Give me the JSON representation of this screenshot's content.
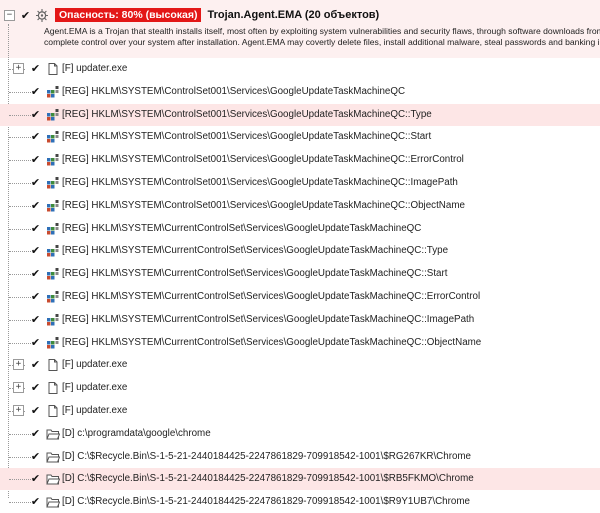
{
  "threat": {
    "collapse_symbol": "−",
    "severity_label": "Опасность: 80% (высокая)",
    "name": "Trojan.Agent.EMA (20 объектов)",
    "description_lines": [
      "Agent.EMA is a Trojan that stealth installs itself, most often by exploiting system vulnerabilities and security flaws, through software downloads from mali",
      "complete control over your system after installation. Agent.EMA may covertly delete files, install additional malware, steal passwords and banking informa"
    ]
  },
  "rows": [
    {
      "type": "file",
      "text": "[F] updater.exe",
      "expandable": true,
      "highlight": false
    },
    {
      "type": "reg",
      "text": "[REG] HKLM\\SYSTEM\\ControlSet001\\Services\\GoogleUpdateTaskMachineQC",
      "expandable": false,
      "highlight": false
    },
    {
      "type": "reg",
      "text": "[REG] HKLM\\SYSTEM\\ControlSet001\\Services\\GoogleUpdateTaskMachineQC::Type",
      "expandable": false,
      "highlight": true
    },
    {
      "type": "reg",
      "text": "[REG] HKLM\\SYSTEM\\ControlSet001\\Services\\GoogleUpdateTaskMachineQC::Start",
      "expandable": false,
      "highlight": false
    },
    {
      "type": "reg",
      "text": "[REG] HKLM\\SYSTEM\\ControlSet001\\Services\\GoogleUpdateTaskMachineQC::ErrorControl",
      "expandable": false,
      "highlight": false
    },
    {
      "type": "reg",
      "text": "[REG] HKLM\\SYSTEM\\ControlSet001\\Services\\GoogleUpdateTaskMachineQC::ImagePath",
      "expandable": false,
      "highlight": false
    },
    {
      "type": "reg",
      "text": "[REG] HKLM\\SYSTEM\\ControlSet001\\Services\\GoogleUpdateTaskMachineQC::ObjectName",
      "expandable": false,
      "highlight": false
    },
    {
      "type": "reg",
      "text": "[REG] HKLM\\SYSTEM\\CurrentControlSet\\Services\\GoogleUpdateTaskMachineQC",
      "expandable": false,
      "highlight": false
    },
    {
      "type": "reg",
      "text": "[REG] HKLM\\SYSTEM\\CurrentControlSet\\Services\\GoogleUpdateTaskMachineQC::Type",
      "expandable": false,
      "highlight": false
    },
    {
      "type": "reg",
      "text": "[REG] HKLM\\SYSTEM\\CurrentControlSet\\Services\\GoogleUpdateTaskMachineQC::Start",
      "expandable": false,
      "highlight": false
    },
    {
      "type": "reg",
      "text": "[REG] HKLM\\SYSTEM\\CurrentControlSet\\Services\\GoogleUpdateTaskMachineQC::ErrorControl",
      "expandable": false,
      "highlight": false
    },
    {
      "type": "reg",
      "text": "[REG] HKLM\\SYSTEM\\CurrentControlSet\\Services\\GoogleUpdateTaskMachineQC::ImagePath",
      "expandable": false,
      "highlight": false
    },
    {
      "type": "reg",
      "text": "[REG] HKLM\\SYSTEM\\CurrentControlSet\\Services\\GoogleUpdateTaskMachineQC::ObjectName",
      "expandable": false,
      "highlight": false
    },
    {
      "type": "file",
      "text": "[F] updater.exe",
      "expandable": true,
      "highlight": false
    },
    {
      "type": "file",
      "text": "[F] updater.exe",
      "expandable": true,
      "highlight": false
    },
    {
      "type": "file",
      "text": "[F] updater.exe",
      "expandable": true,
      "highlight": false
    },
    {
      "type": "dir",
      "text": "[D] c:\\programdata\\google\\chrome",
      "expandable": false,
      "highlight": false
    },
    {
      "type": "dir",
      "text": "[D] C:\\$Recycle.Bin\\S-1-5-21-2440184425-2247861829-709918542-1001\\$RG267KR\\Chrome",
      "expandable": false,
      "highlight": false
    },
    {
      "type": "dir",
      "text": "[D] C:\\$Recycle.Bin\\S-1-5-21-2440184425-2247861829-709918542-1001\\$RB5FKMO\\Chrome",
      "expandable": false,
      "highlight": true
    },
    {
      "type": "dir",
      "text": "[D] C:\\$Recycle.Bin\\S-1-5-21-2440184425-2247861829-709918542-1001\\$R9Y1UB7\\Chrome",
      "expandable": false,
      "highlight": false
    }
  ],
  "symbols": {
    "checked": "✔",
    "expand": "+"
  },
  "colors": {
    "severity_bg": "#e31717",
    "highlight_row": "#fde6e6",
    "header_bg": "#fdf0f0"
  }
}
